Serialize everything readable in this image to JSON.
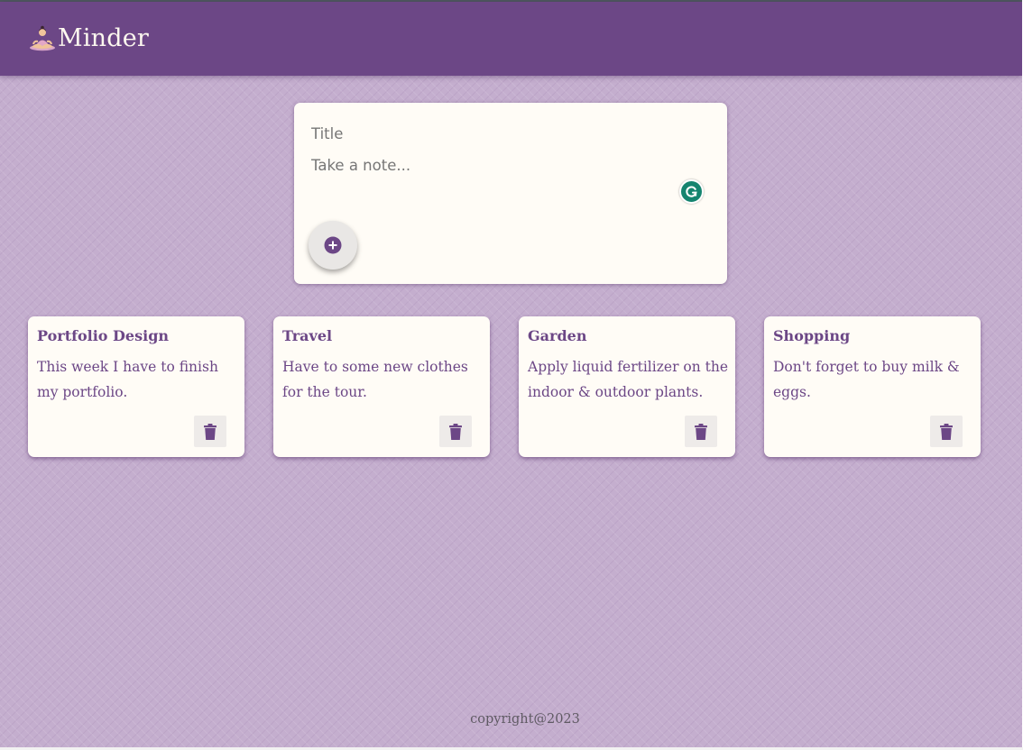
{
  "app": {
    "name": "Minder",
    "logo_icon": "meditating-person-icon",
    "accent_color": "#6c4786"
  },
  "create_note": {
    "title_placeholder": "Title",
    "content_placeholder": "Take a note...",
    "add_button_icon": "add-circle-icon",
    "grammarly_icon": "grammarly-icon"
  },
  "notes": [
    {
      "title": "Portfolio Design",
      "content": "This week I have to finish my portfolio.",
      "delete_icon": "trash-icon"
    },
    {
      "title": "Travel",
      "content": "Have to some new clothes for the tour.",
      "delete_icon": "trash-icon"
    },
    {
      "title": "Garden",
      "content": "Apply liquid fertilizer on the indoor & outdoor plants.",
      "delete_icon": "trash-icon"
    },
    {
      "title": "Shopping",
      "content": "Don't forget to buy milk & eggs.",
      "delete_icon": "trash-icon"
    }
  ],
  "footer": {
    "text": "copyright@2023"
  }
}
